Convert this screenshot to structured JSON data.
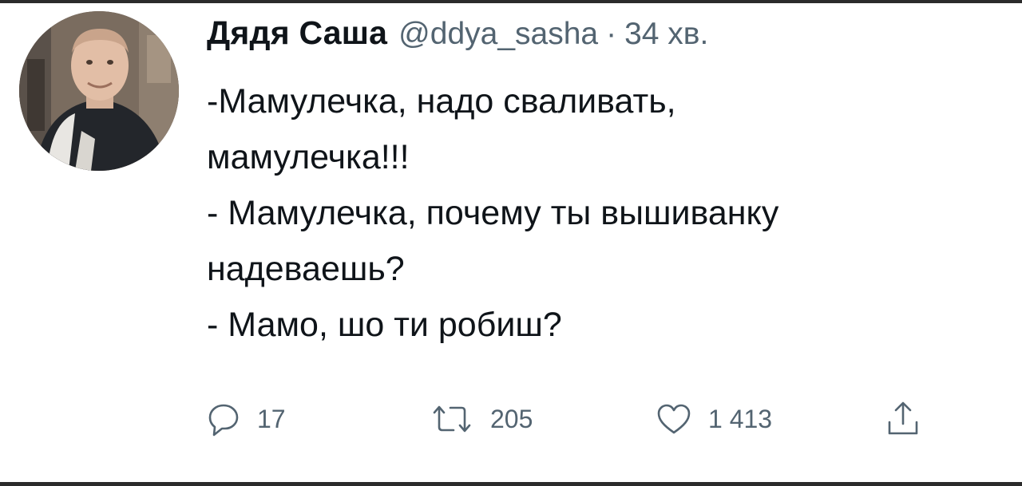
{
  "tweet": {
    "author": {
      "display_name": "Дядя Саша",
      "handle": "@ddya_sasha"
    },
    "separator": "·",
    "time": "34 хв.",
    "lines": [
      "-Мамулечка, надо сваливать,",
      "мамулечка!!!",
      "- Мамулечка, почему ты вышиванку",
      "надеваешь?",
      "- Мамо, шо ти робиш?"
    ],
    "actions": {
      "reply": {
        "icon": "reply-icon",
        "count": "17"
      },
      "retweet": {
        "icon": "retweet-icon",
        "count": "205"
      },
      "like": {
        "icon": "heart-icon",
        "count": "1 413"
      },
      "share": {
        "icon": "share-icon"
      }
    }
  },
  "colors": {
    "text": "#0f1419",
    "secondary": "#536471",
    "background": "#ffffff"
  }
}
